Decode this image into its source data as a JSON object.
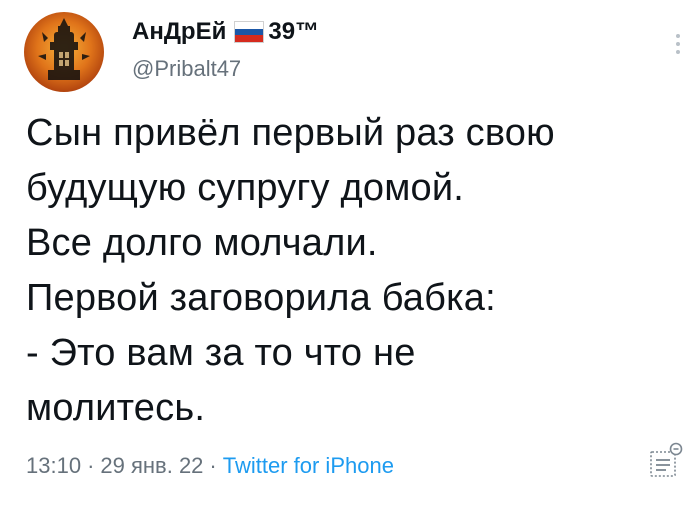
{
  "tweet": {
    "author_name": "АнДрЕй",
    "author_suffix": "39™",
    "handle": "@Pribalt47",
    "lines": [
      "Сын привёл первый раз свою",
      "будущую супругу домой.",
      "Все долго молчали.",
      "Первой заговорила бабка:",
      "- Это вам за то что не",
      "молитесь."
    ],
    "time": "13:10",
    "date": "29 янв. 22",
    "source": "Twitter for iPhone",
    "separator": "·"
  },
  "icons": {
    "avatar": "avatar-image",
    "flag": "russia-flag-icon",
    "more": "more-options-icon",
    "analytics": "tweet-analytics-icon"
  },
  "colors": {
    "text": "#0f1419",
    "secondary": "#66717b",
    "link": "#1d9bf0",
    "background": "#ffffff"
  }
}
